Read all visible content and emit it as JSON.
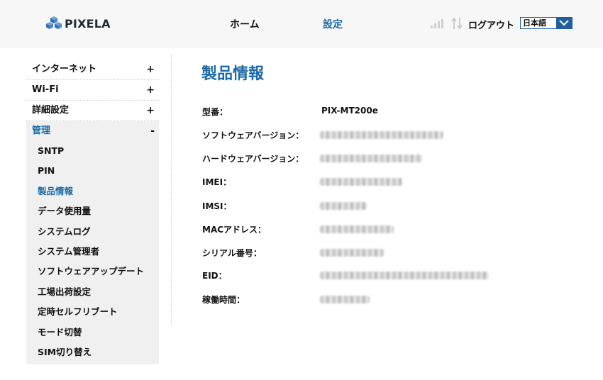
{
  "header": {
    "brand": "PIXELA",
    "nav": [
      {
        "label": "ホーム",
        "active": false
      },
      {
        "label": "設定",
        "active": true
      }
    ],
    "logout_label": "ログアウト",
    "language": {
      "selected": "日本語"
    },
    "icons": [
      "signal-strength-icon",
      "data-transfer-icon",
      "chevron-down-icon"
    ]
  },
  "sidebar": {
    "groups": [
      {
        "label": "インターネット",
        "toggle": "+"
      },
      {
        "label": "Wi-Fi",
        "toggle": "+"
      },
      {
        "label": "詳細設定",
        "toggle": "+"
      },
      {
        "label": "管理",
        "toggle": "-"
      }
    ],
    "sub_items": [
      "SNTP",
      "PIN",
      "製品情報",
      "データ使用量",
      "システムログ",
      "システム管理者",
      "ソフトウェアアップデート",
      "工場出荷設定",
      "定時セルフリブート",
      "モード切替",
      "SIM切り替え"
    ],
    "current_sub_item": "製品情報"
  },
  "main": {
    "title": "製品情報",
    "rows": [
      {
        "label": "型番：",
        "value": "PIX-MT200e",
        "masked": false
      },
      {
        "label": "ソフトウェアバージョン：",
        "value": "",
        "masked": true
      },
      {
        "label": "ハードウェアバージョン：",
        "value": "",
        "masked": true
      },
      {
        "label": "IMEI：",
        "value": "",
        "masked": true
      },
      {
        "label": "IMSI：",
        "value": "",
        "masked": true
      },
      {
        "label": "MACアドレス：",
        "value": "",
        "masked": true
      },
      {
        "label": "シリアル番号：",
        "value": "",
        "masked": true
      },
      {
        "label": "EID：",
        "value": "",
        "masked": true
      },
      {
        "label": "稼働時間：",
        "value": "",
        "masked": true
      }
    ]
  },
  "colors": {
    "accent": "#1a6aa8",
    "header_bg": "#f7f7f7",
    "select_blue": "#1f5fa0"
  }
}
